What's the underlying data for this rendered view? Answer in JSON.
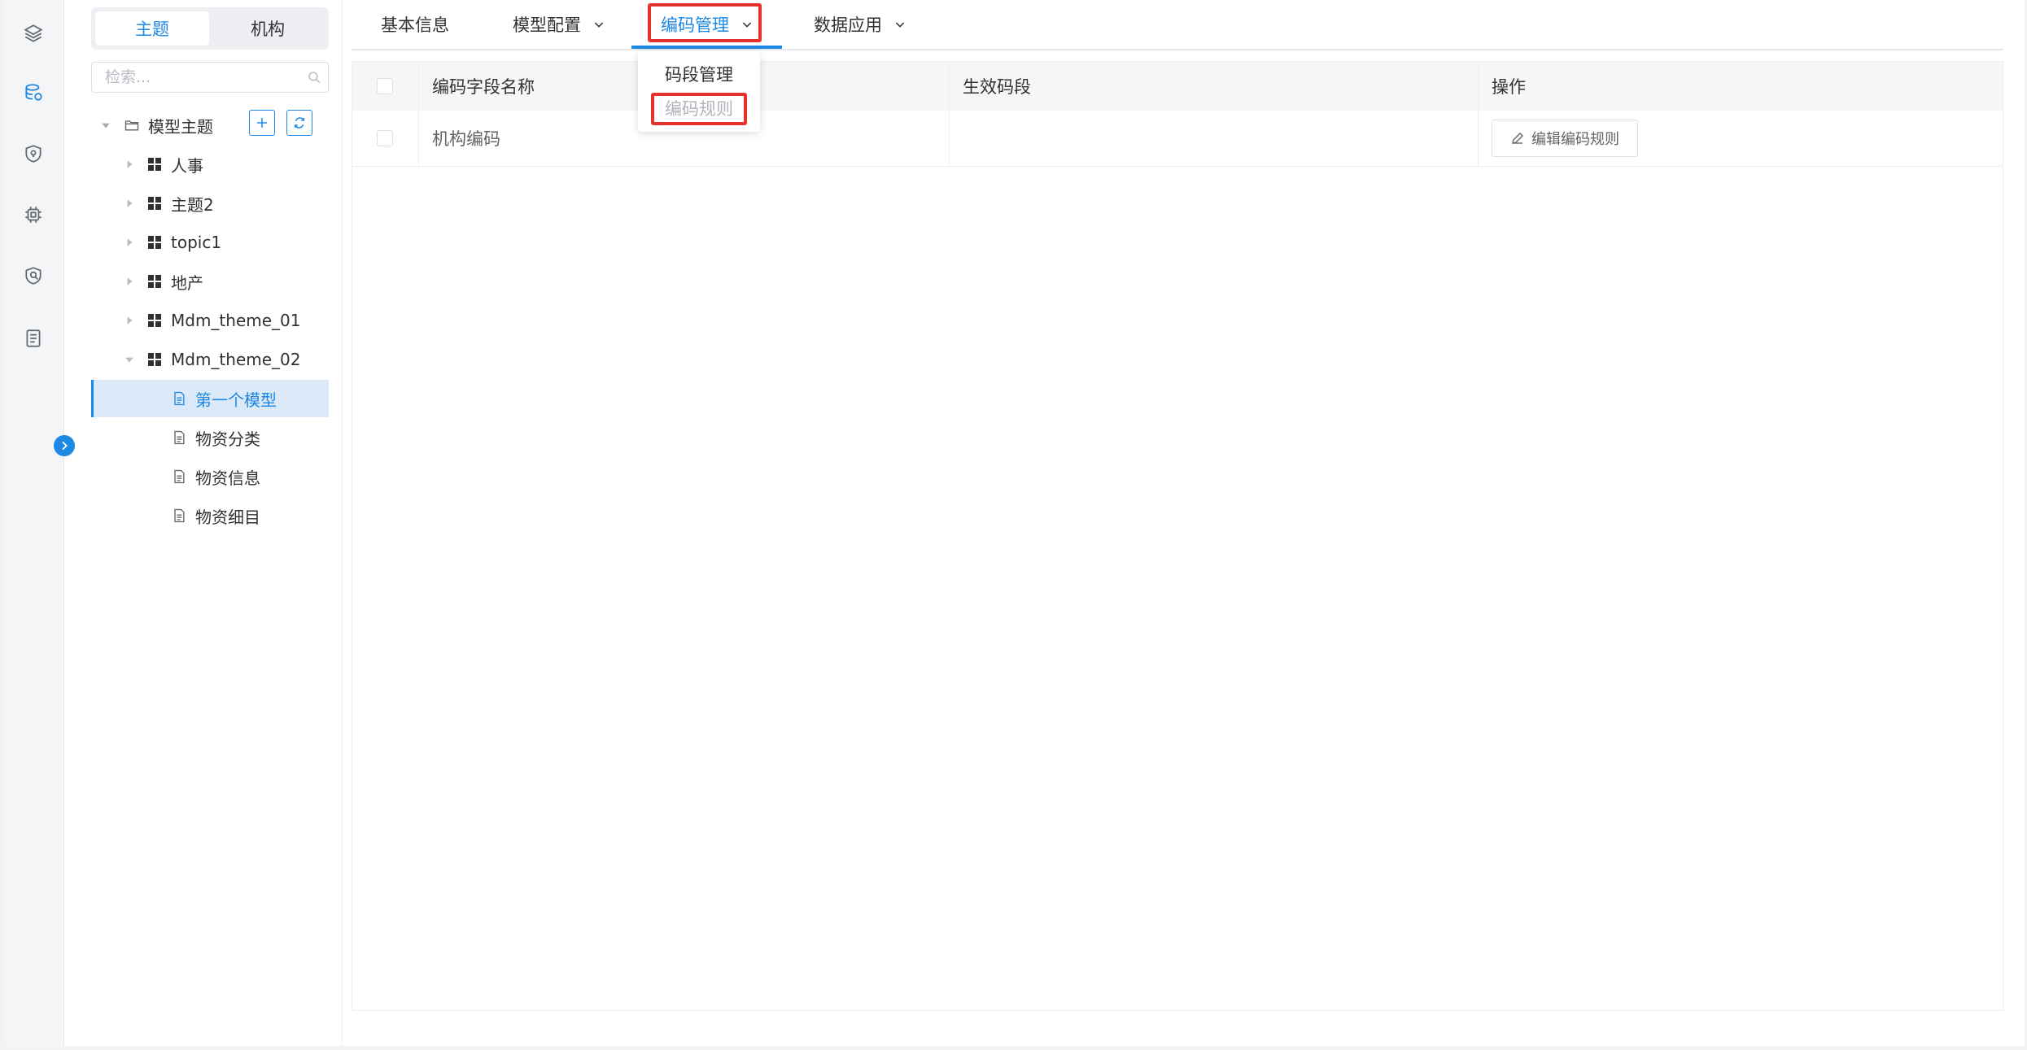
{
  "rail": {
    "items": [
      "layers-icon",
      "database-icon",
      "shield-pin-icon",
      "chip-icon",
      "shield-user-icon",
      "document-list-icon"
    ],
    "toggle_icon": "chevron-right-icon"
  },
  "tree": {
    "segment": {
      "active": "主题",
      "inactive": "机构"
    },
    "search_placeholder": "检索...",
    "root_label": "模型主题",
    "themes": [
      "人事",
      "主题2",
      "topic1",
      "地产",
      "Mdm_theme_01",
      "Mdm_theme_02"
    ],
    "models": [
      "第一个模型",
      "物资分类",
      "物资信息",
      "物资细目"
    ],
    "selected_model": "第一个模型"
  },
  "tabs": [
    "基本信息",
    "模型配置",
    "编码管理",
    "数据应用"
  ],
  "active_tab": "编码管理",
  "dropdown": {
    "items": [
      "码段管理",
      "编码规则"
    ],
    "highlighted": "编码规则"
  },
  "table": {
    "columns": [
      "编码字段名称",
      "生效码段",
      "操作"
    ],
    "rows": [
      {
        "name": "机构编码",
        "segment": "",
        "action": "编辑编码规则"
      }
    ]
  },
  "colors": {
    "accent": "#1e88e5",
    "highlight": "#e5322d",
    "selected_bg": "#dbe9f8"
  }
}
